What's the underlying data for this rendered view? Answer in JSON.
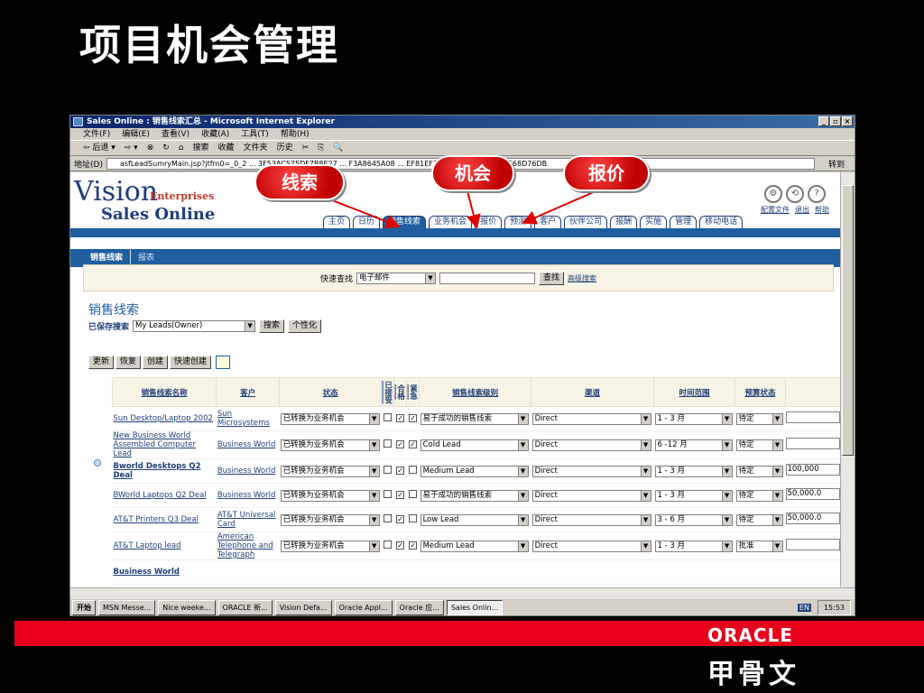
{
  "slide": {
    "title": "项目机会管理",
    "callouts": [
      "线索",
      "机会",
      "报价"
    ]
  },
  "window": {
    "title": "Sales Online : 销售线索汇总 - Microsoft Internet Explorer",
    "buttons": [
      "_",
      "▫",
      "×"
    ]
  },
  "menu": [
    "文件(F)",
    "编辑(E)",
    "查看(V)",
    "收藏(A)",
    "工具(T)",
    "帮助(H)"
  ],
  "toolbar": [
    "⇦ 后退 ▾",
    "⇨ ▾",
    "⊗",
    "↻",
    "⌂",
    "搜索",
    "收藏",
    "文件夹",
    "历史",
    "✂",
    "⎘",
    "🔍"
  ],
  "address": {
    "label": "地址(D)",
    "value": "asfLeadSumryMain.jsp?jtfm0=_0_2 ... 3F53AC575DF7B8E27 ... F3A8645A08 ... EF81EF7E53D0825D40F3E6E68D76DB",
    "go": "转到"
  },
  "app": {
    "logo_vision": "Vision",
    "logo_enterprises": "Enterprises",
    "logo_sales": "Sales Online",
    "util_links": [
      "配置文件",
      "退出",
      "帮助"
    ],
    "tabs": [
      "主页",
      "日历",
      "销售线索",
      "业务机会",
      "报价",
      "预测",
      "客户",
      "伙伴公司",
      "报酬",
      "实施",
      "管理",
      "移动电话"
    ],
    "active_tab": "销售线索",
    "subnav": [
      "销售线索",
      "报表"
    ]
  },
  "quick_search": {
    "label": "快速查找",
    "field": "电子邮件",
    "button": "查找",
    "advanced": "高级搜索"
  },
  "section": {
    "title": "销售线索",
    "saved_label": "已保存搜索",
    "saved_value": "My Leads(Owner)",
    "search_btn": "搜索",
    "personalize_btn": "个性化"
  },
  "actions": [
    "更新",
    "恢复",
    "创建",
    "快速创建"
  ],
  "table": {
    "headers": [
      "销售线索名称",
      "客户",
      "状态",
      "已接受",
      "合格",
      "紧急",
      "销售线索级别",
      "渠道",
      "时间范围",
      "预算状态",
      ""
    ],
    "rows": [
      {
        "name": "Sun Desktop/Laptop 2002",
        "customer": "Sun Microsystems",
        "status": "已转换为业务机会",
        "accepted": "",
        "qualified": "✓",
        "urgent": "✓",
        "rank": "易于成功的销售线索",
        "channel": "Direct",
        "timeframe": "1 - 3 月",
        "budget": "待定",
        "amount": ""
      },
      {
        "name": "New Business World Assembled Computer Lead",
        "customer": "Business World",
        "status": "已转换为业务机会",
        "accepted": "",
        "qualified": "✓",
        "urgent": "✓",
        "rank": "Cold Lead",
        "channel": "Direct",
        "timeframe": "6 -12 月",
        "budget": "待定",
        "amount": ""
      },
      {
        "name": "Bworld Desktops Q2 Deal",
        "customer": "Business World",
        "status": "已转换为业务机会",
        "accepted": "",
        "qualified": "✓",
        "urgent": "",
        "rank": "Medium Lead",
        "channel": "Direct",
        "timeframe": "1 - 3 月",
        "budget": "待定",
        "amount": "100,000"
      },
      {
        "name": "BWorld Laptops Q2 Deal",
        "customer": "Business World",
        "status": "已转换为业务机会",
        "accepted": "",
        "qualified": "✓",
        "urgent": "",
        "rank": "易于成功的销售线索",
        "channel": "Direct",
        "timeframe": "1 - 3 月",
        "budget": "待定",
        "amount": "50,000.0"
      },
      {
        "name": "AT&T Printers Q3 Deal",
        "customer": "AT&T Universal Card",
        "status": "已转换为业务机会",
        "accepted": "",
        "qualified": "✓",
        "urgent": "",
        "rank": "Low Lead",
        "channel": "Direct",
        "timeframe": "3 - 6 月",
        "budget": "待定",
        "amount": "50,000.0"
      },
      {
        "name": "AT&T Laptop lead",
        "customer": "American Telephone and Telegraph",
        "status": "已转换为业务机会",
        "accepted": "",
        "qualified": "✓",
        "urgent": "✓",
        "rank": "Medium Lead",
        "channel": "Direct",
        "timeframe": "1 - 3 月",
        "budget": "批准",
        "amount": ""
      },
      {
        "name": "Business World",
        "customer": "",
        "status": "",
        "accepted": "",
        "qualified": "",
        "urgent": "",
        "rank": "",
        "channel": "",
        "timeframe": "",
        "budget": "",
        "amount": ""
      }
    ]
  },
  "taskbar": {
    "start": "开始",
    "tasks": [
      "MSN Messe...",
      "Nice weeke...",
      "ORACLE 新...",
      "Vision Defa...",
      "Oracle Appl...",
      "Oracle 应...",
      "Sales Onlin..."
    ],
    "active_task": "Sales Onlin...",
    "lang": "EN",
    "clock": "15:53"
  },
  "footer": {
    "oracle": "ORACLE",
    "cn": "甲骨文"
  },
  "colors": {
    "accent_red": "#e8001c",
    "app_blue": "#1f5fa0",
    "callout_red": "#c00000"
  }
}
